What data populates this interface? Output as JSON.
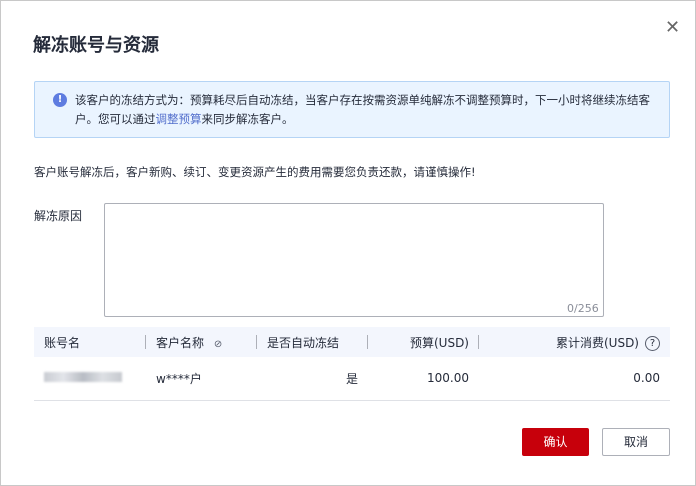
{
  "dialog": {
    "title": "解冻账号与资源",
    "close_icon": "close-icon"
  },
  "alert": {
    "text_before": "该客户的冻结方式为：预算耗尽后自动冻结，当客户存在按需资源单纯解冻不调整预算时，下一小时将继续冻结客户。您可以通过",
    "link": "调整预算",
    "text_after": "来同步解冻客户。",
    "icon": "info-icon",
    "color": "#5e7ce0"
  },
  "warning": "客户账号解冻后，客户新购、续订、变更资源产生的费用需要您负责还款，请谨慎操作!",
  "reason": {
    "label": "解冻原因",
    "value": "",
    "counter": "0/256"
  },
  "table": {
    "headers": [
      "账号名",
      "客户名称",
      "是否自动冻结",
      "预算(USD)",
      "累计消费(USD)"
    ],
    "rows": [
      {
        "account": "",
        "customer": "w****户",
        "auto_freeze": "是",
        "budget": "100.00",
        "spent": "0.00"
      }
    ]
  },
  "buttons": {
    "confirm": "确认",
    "cancel": "取消",
    "confirm_color": "#c7000b"
  }
}
